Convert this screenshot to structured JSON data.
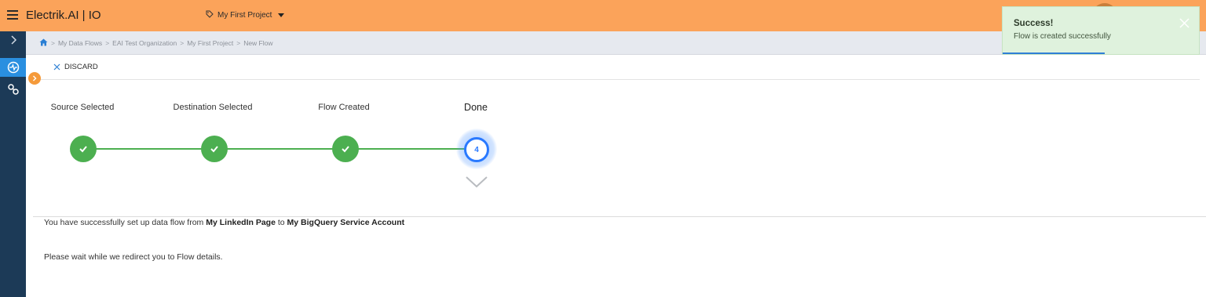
{
  "app": {
    "title": "Electrik.AI | IO"
  },
  "project": {
    "selected": "My First Project"
  },
  "breadcrumb": [
    "My Data Flows",
    "EAI Test Organization",
    "My First Project",
    "New Flow"
  ],
  "toolbar": {
    "discard_label": "DISCARD"
  },
  "stepper": {
    "steps": [
      {
        "label": "Source Selected",
        "status": "complete"
      },
      {
        "label": "Destination Selected",
        "status": "complete"
      },
      {
        "label": "Flow Created",
        "status": "complete"
      },
      {
        "label": "Done",
        "status": "current",
        "number": "4"
      }
    ]
  },
  "result": {
    "prefix": "You have successfully set up data flow from",
    "source": "My LinkedIn Page",
    "connector": "to",
    "destination": "My BigQuery Service Account",
    "wait": "Please wait while we redirect you to Flow details."
  },
  "toast": {
    "title": "Success!",
    "message": "Flow is created successfully",
    "progress": 0.52
  },
  "colors": {
    "topbar": "#fba35a",
    "rail": "#1c3a57",
    "accent": "#2979ff",
    "success": "#4caf50",
    "toast_bg": "#dff2dd"
  },
  "icons": {
    "menu": "hamburger-icon",
    "project": "tag-icon",
    "home": "home-icon",
    "discard": "close-icon",
    "check": "check-icon",
    "expand": "chevron-down-icon"
  }
}
